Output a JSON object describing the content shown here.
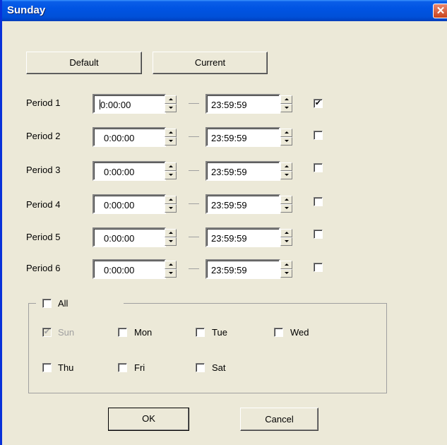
{
  "window": {
    "title": "Sunday",
    "close_glyph": "✕"
  },
  "buttons": {
    "default": "Default",
    "current": "Current",
    "ok": "OK",
    "cancel": "Cancel"
  },
  "periods": [
    {
      "label": "Period 1",
      "start": "0:00:00",
      "end": "23:59:59",
      "enabled": true
    },
    {
      "label": "Period 2",
      "start": "0:00:00",
      "end": "23:59:59",
      "enabled": false
    },
    {
      "label": "Period 3",
      "start": "0:00:00",
      "end": "23:59:59",
      "enabled": false
    },
    {
      "label": "Period 4",
      "start": "0:00:00",
      "end": "23:59:59",
      "enabled": false
    },
    {
      "label": "Period 5",
      "start": "0:00:00",
      "end": "23:59:59",
      "enabled": false
    },
    {
      "label": "Period 6",
      "start": "0:00:00",
      "end": "23:59:59",
      "enabled": false
    }
  ],
  "days": {
    "all_label": "All",
    "all_checked": false,
    "sun": "Sun",
    "sun_checked": true,
    "sun_disabled": true,
    "mon": "Mon",
    "tue": "Tue",
    "wed": "Wed",
    "thu": "Thu",
    "fri": "Fri",
    "sat": "Sat"
  },
  "icons": {
    "spin": "spinner-icon",
    "check": "✔"
  },
  "colors": {
    "titlebar": "#0054e3",
    "face": "#ece9d8",
    "close": "#c8431c"
  }
}
